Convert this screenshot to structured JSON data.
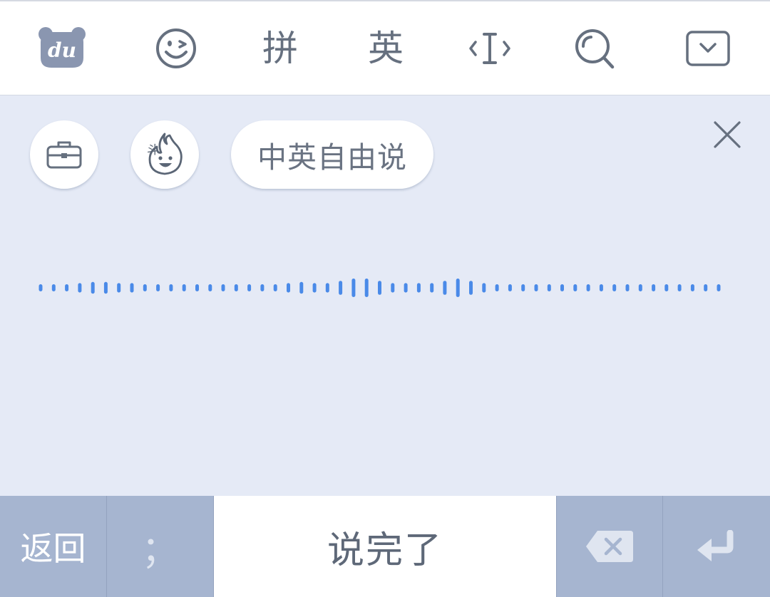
{
  "toolbar": {
    "logo_text": "du",
    "items": [
      {
        "name": "logo-icon"
      },
      {
        "name": "emoji-icon"
      },
      {
        "label": "拼"
      },
      {
        "label": "英"
      },
      {
        "name": "cursor-icon"
      },
      {
        "name": "search-icon"
      },
      {
        "name": "collapse-keyboard-icon"
      }
    ],
    "pinyin_label": "拼",
    "english_label": "英"
  },
  "voice_panel": {
    "chips": [
      {
        "icon": "briefcase-icon"
      },
      {
        "icon": "flame-mascot-icon",
        "mascot_glyph": "斗"
      },
      {
        "label": "中英自由说"
      }
    ],
    "mode_label": "中英自由说",
    "mascot_glyph": "斗",
    "close_icon": "close-icon",
    "waveform": {
      "color": "#4a8ae8",
      "levels": [
        0.5,
        0.5,
        0.5,
        0.6,
        0.7,
        0.7,
        0.6,
        0.6,
        0.5,
        0.5,
        0.5,
        0.5,
        0.5,
        0.5,
        0.5,
        0.5,
        0.5,
        0.5,
        0.5,
        0.6,
        0.7,
        0.6,
        0.6,
        0.8,
        1.0,
        1.0,
        0.8,
        0.6,
        0.6,
        0.6,
        0.6,
        0.8,
        1.0,
        0.8,
        0.6,
        0.5,
        0.5,
        0.5,
        0.5,
        0.5,
        0.5,
        0.5,
        0.5,
        0.5,
        0.5,
        0.5,
        0.5,
        0.5,
        0.5,
        0.5,
        0.5,
        0.5,
        0.5
      ]
    }
  },
  "bottom_bar": {
    "back_label": "返回",
    "punct_label": "；",
    "done_label": "说完了",
    "delete_icon": "backspace-icon",
    "enter_icon": "enter-icon"
  },
  "colors": {
    "toolbar_bg": "#ffffff",
    "panel_bg": "#e5eaf6",
    "key_bg": "#a6b5d0",
    "icon_gray": "#66707f",
    "logo_gray": "#8a96b0",
    "wave_blue": "#4a8ae8"
  }
}
